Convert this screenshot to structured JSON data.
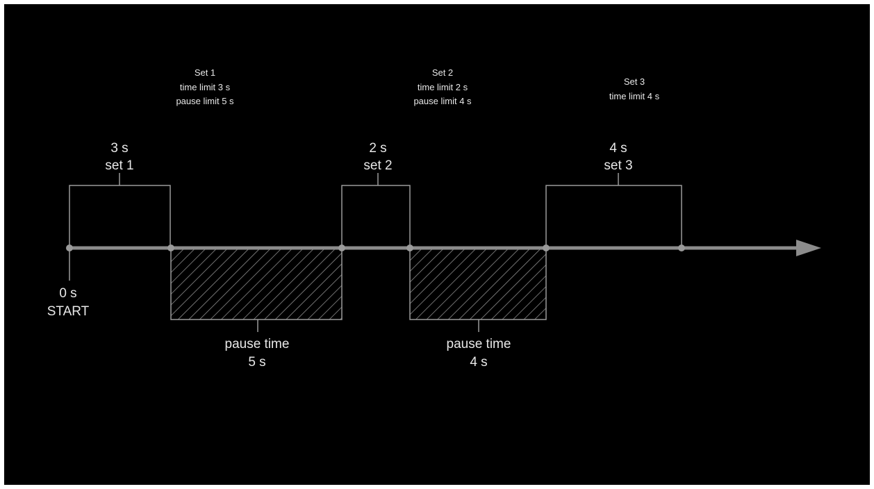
{
  "colors": {
    "background": "#000000",
    "frame": "#ffffff",
    "axis": "#8c8c8c",
    "line": "#9a9a9a",
    "text": "#e8e8e8"
  },
  "captions": [
    {
      "lines": [
        "Set 1",
        "time limit 3 s",
        "pause limit 5 s"
      ]
    },
    {
      "lines": [
        "Set 2",
        "time limit 2 s",
        "pause limit 4 s"
      ]
    },
    {
      "lines": [
        "Set 3",
        "time limit 4 s"
      ]
    }
  ],
  "sets": [
    {
      "duration": "3 s",
      "name": "set 1",
      "time_limit_s": 3
    },
    {
      "duration": "2 s",
      "name": "set 2",
      "time_limit_s": 2
    },
    {
      "duration": "4 s",
      "name": "set 3",
      "time_limit_s": 4
    }
  ],
  "pauses": [
    {
      "label": "pause time",
      "duration": "5 s",
      "pause_s": 5
    },
    {
      "label": "pause time",
      "duration": "4 s",
      "pause_s": 4
    }
  ],
  "start": {
    "time": "0 s",
    "label": "START"
  }
}
